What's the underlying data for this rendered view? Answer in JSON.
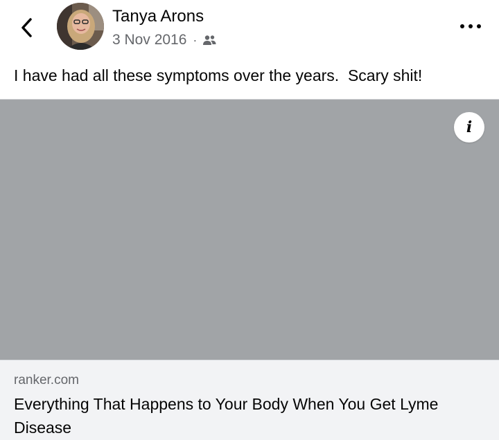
{
  "post": {
    "author": "Tanya Arons",
    "date": "3 Nov 2016",
    "separator": "·",
    "audience_icon": "friends-icon",
    "text": "I have had all these symptoms over the years.  Scary shit!"
  },
  "link": {
    "domain": "ranker.com",
    "title": "Everything That Happens to Your Body When You Get Lyme Disease",
    "image_color": "#a1a4a7"
  },
  "icons": {
    "back": "back-chevron-icon",
    "more": "more-options-icon",
    "info": "info-icon",
    "info_glyph": "i"
  }
}
